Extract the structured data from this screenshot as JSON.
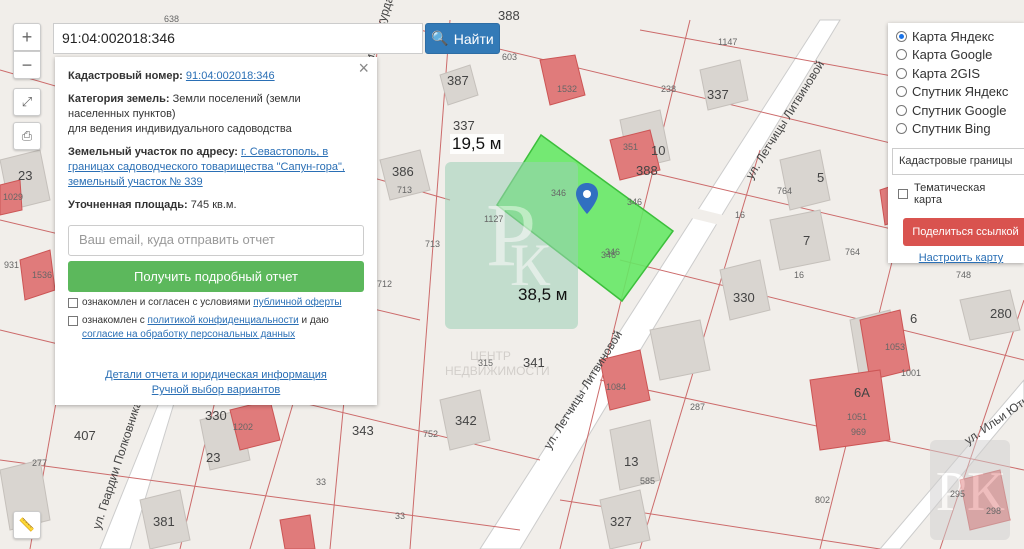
{
  "search": {
    "value": "91:04:002018:346",
    "button_label": "Найти"
  },
  "zoom": {
    "plus": "+",
    "minus": "−"
  },
  "info": {
    "cadastral_label": "Кадастровый номер:",
    "cadastral_value": "91:04:002018:346",
    "category_label": "Категория земель:",
    "category_value": "Земли поселений (земли населенных пунктов)",
    "category_value2": "для ведения индивидуального садоводства",
    "address_label": "Земельный участок по адресу:",
    "address_value": "г. Севастополь, в границах садоводческого товарищества \"Сапун-гора\", земельный участок № 339",
    "area_label": "Уточненная площадь:",
    "area_value": "745 кв.м.",
    "email_placeholder": "Ваш email, куда отправить отчет",
    "report_button": "Получить подробный отчет",
    "consent1_pre": "ознакомлен и согласен с условиями ",
    "consent1_link": "публичной оферты",
    "consent2_pre": "ознакомлен с ",
    "consent2_link": "политикой конфиденциальности",
    "consent2_mid": " и даю ",
    "consent2_link2": "согласие на обработку персональных данных",
    "details_link": "Детали отчета и юридическая информация",
    "manual_link": "Ручной выбор вариантов"
  },
  "layers": {
    "options": [
      "Карта Яндекс",
      "Карта Google",
      "Карта 2GIS",
      "Спутник Яндекс",
      "Спутник Google",
      "Спутник Bing"
    ],
    "selected": "Карта Яндекс",
    "select_value": "Кадастровые границы",
    "thematic": "Тематическая карта",
    "share_button": "Поделиться ссылкой",
    "configure_link": "Настроить карту"
  },
  "measures": {
    "top": "19,5 м",
    "bottom": "38,5 м"
  },
  "watermark": {
    "letters": "РК",
    "line1": "ЦЕНТР",
    "line2": "НЕДВИЖИМОСТИ"
  },
  "streets": [
    "ул. Летчицы Литвиновой",
    "ул. Летчицы Литвиновой",
    "ул. Гвардии Полковника Закурдаева",
    "ул. Ильи Юткевича",
    "ул. Полковника Закурдаева"
  ],
  "parcel_numbers": [
    "388",
    "1147",
    "638",
    "603",
    "387",
    "238",
    "337",
    "337",
    "1532",
    "351",
    "10",
    "388",
    "386",
    "713",
    "346",
    "346",
    "346",
    "764",
    "5",
    "16",
    "1127",
    "713",
    "7",
    "764",
    "16",
    "712",
    "330",
    "748",
    "280",
    "6",
    "1053",
    "341",
    "315",
    "1001",
    "1084",
    "6А",
    "287",
    "1051",
    "969",
    "407",
    "330",
    "1202",
    "343",
    "752",
    "342",
    "13",
    "585",
    "277",
    "23",
    "33",
    "381",
    "327",
    "802",
    "295",
    "298",
    "33",
    "23",
    "931",
    "1536",
    "1029",
    "346"
  ],
  "colors": {
    "accent": "#337ab7",
    "green_button": "#5cb85c",
    "red_button": "#d9534f",
    "parcel_fill": "#66e866",
    "building": "#e07b7b",
    "road": "#ffffff"
  }
}
